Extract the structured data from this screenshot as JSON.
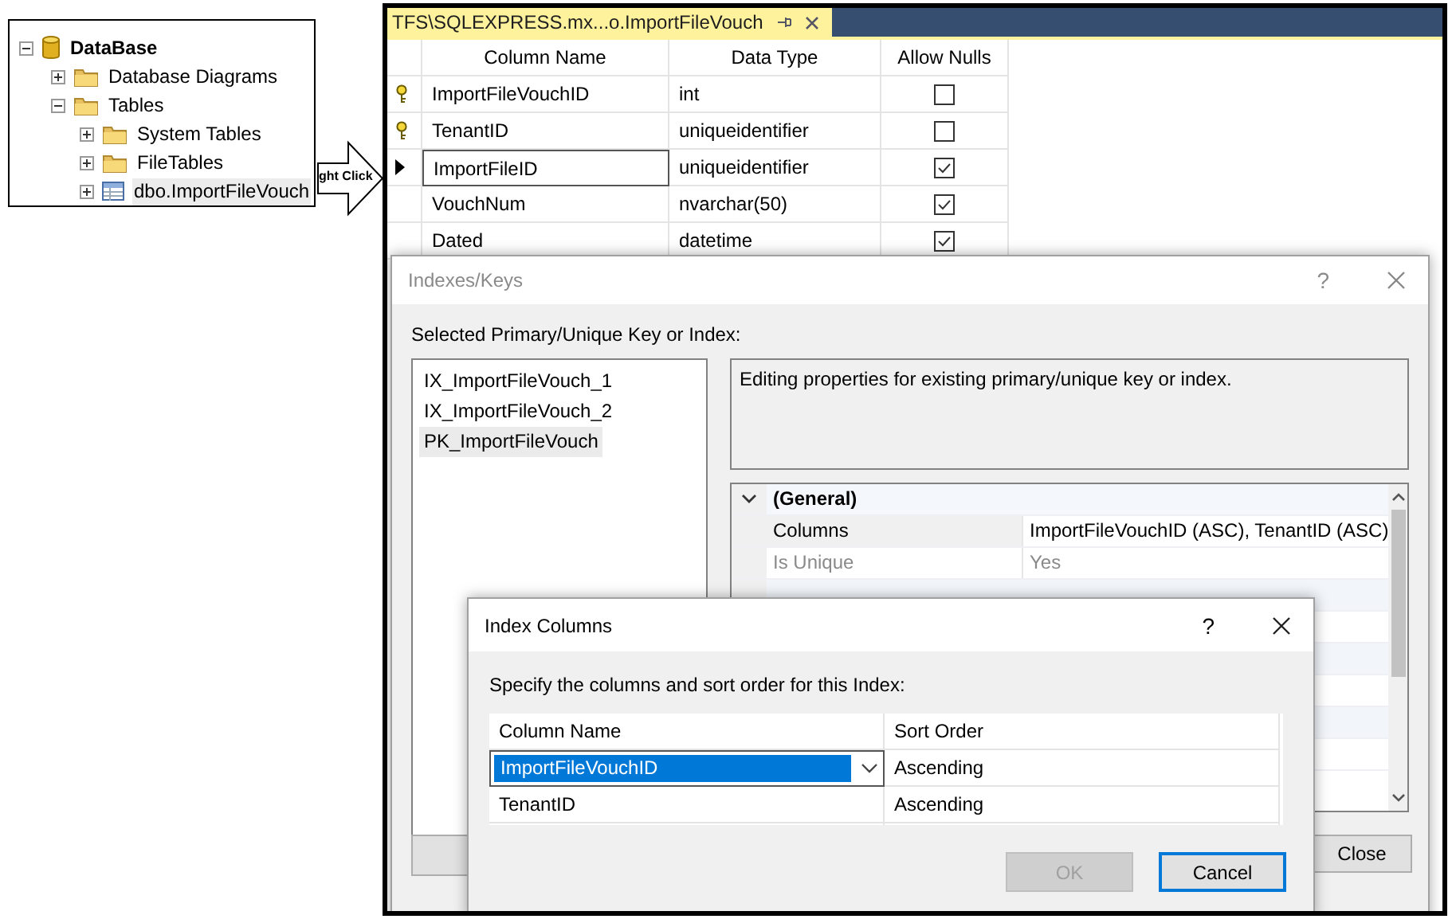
{
  "object_explorer": {
    "nodes": [
      {
        "label": "DataBase",
        "kind": "database",
        "expanded": true,
        "selected": false,
        "children": [
          {
            "label": "Database Diagrams",
            "kind": "folder",
            "expanded": false,
            "selected": false
          },
          {
            "label": "Tables",
            "kind": "folder",
            "expanded": true,
            "selected": false,
            "children": [
              {
                "label": "System Tables",
                "kind": "folder",
                "expanded": false,
                "selected": false
              },
              {
                "label": "FileTables",
                "kind": "folder",
                "expanded": false,
                "selected": false
              },
              {
                "label": "dbo.ImportFileVouch",
                "kind": "table",
                "expanded": false,
                "selected": true
              }
            ]
          }
        ]
      }
    ]
  },
  "callout": {
    "text": "ght Click"
  },
  "designer": {
    "tab": {
      "title": "TFS\\SQLEXPRESS.mx...o.ImportFileVouch"
    },
    "columns": [
      "Column Name",
      "Data Type",
      "Allow Nulls"
    ],
    "rows": [
      {
        "name": "ImportFileVouchID",
        "data_type": "int",
        "allow_nulls": false,
        "primary_key": true,
        "selected": false
      },
      {
        "name": "TenantID",
        "data_type": "uniqueidentifier",
        "allow_nulls": false,
        "primary_key": true,
        "selected": false
      },
      {
        "name": "ImportFileID",
        "data_type": "uniqueidentifier",
        "allow_nulls": true,
        "primary_key": false,
        "selected": true
      },
      {
        "name": "VouchNum",
        "data_type": "nvarchar(50)",
        "allow_nulls": true,
        "primary_key": false,
        "selected": false
      },
      {
        "name": "Dated",
        "data_type": "datetime",
        "allow_nulls": true,
        "primary_key": false,
        "selected": false
      }
    ]
  },
  "indexes_dialog": {
    "title": "Indexes/Keys",
    "help": "?",
    "label": "Selected Primary/Unique Key or Index:",
    "items": [
      {
        "label": "IX_ImportFileVouch_1",
        "selected": false
      },
      {
        "label": "IX_ImportFileVouch_2",
        "selected": false
      },
      {
        "label": "PK_ImportFileVouch",
        "selected": true
      }
    ],
    "description": "Editing properties for existing primary/unique key or index.",
    "properties": [
      {
        "kind": "category",
        "label": "(General)",
        "expanded": true
      },
      {
        "kind": "property",
        "name": "Columns",
        "value": "ImportFileVouchID (ASC), TenantID (ASC)",
        "disabled": false
      },
      {
        "kind": "property",
        "name": "Is Unique",
        "value": "Yes",
        "disabled": true
      }
    ],
    "close_button": "Close"
  },
  "index_columns_dialog": {
    "title": "Index Columns",
    "help": "?",
    "instruction": "Specify the columns and sort order for this Index:",
    "columns": [
      "Column Name",
      "Sort Order"
    ],
    "rows": [
      {
        "column": "ImportFileVouchID",
        "sort_order": "Ascending",
        "selected": true
      },
      {
        "column": "TenantID",
        "sort_order": "Ascending",
        "selected": false
      }
    ],
    "buttons": [
      {
        "label": "OK",
        "disabled": true,
        "focused": false
      },
      {
        "label": "Cancel",
        "disabled": false,
        "focused": true
      }
    ]
  }
}
